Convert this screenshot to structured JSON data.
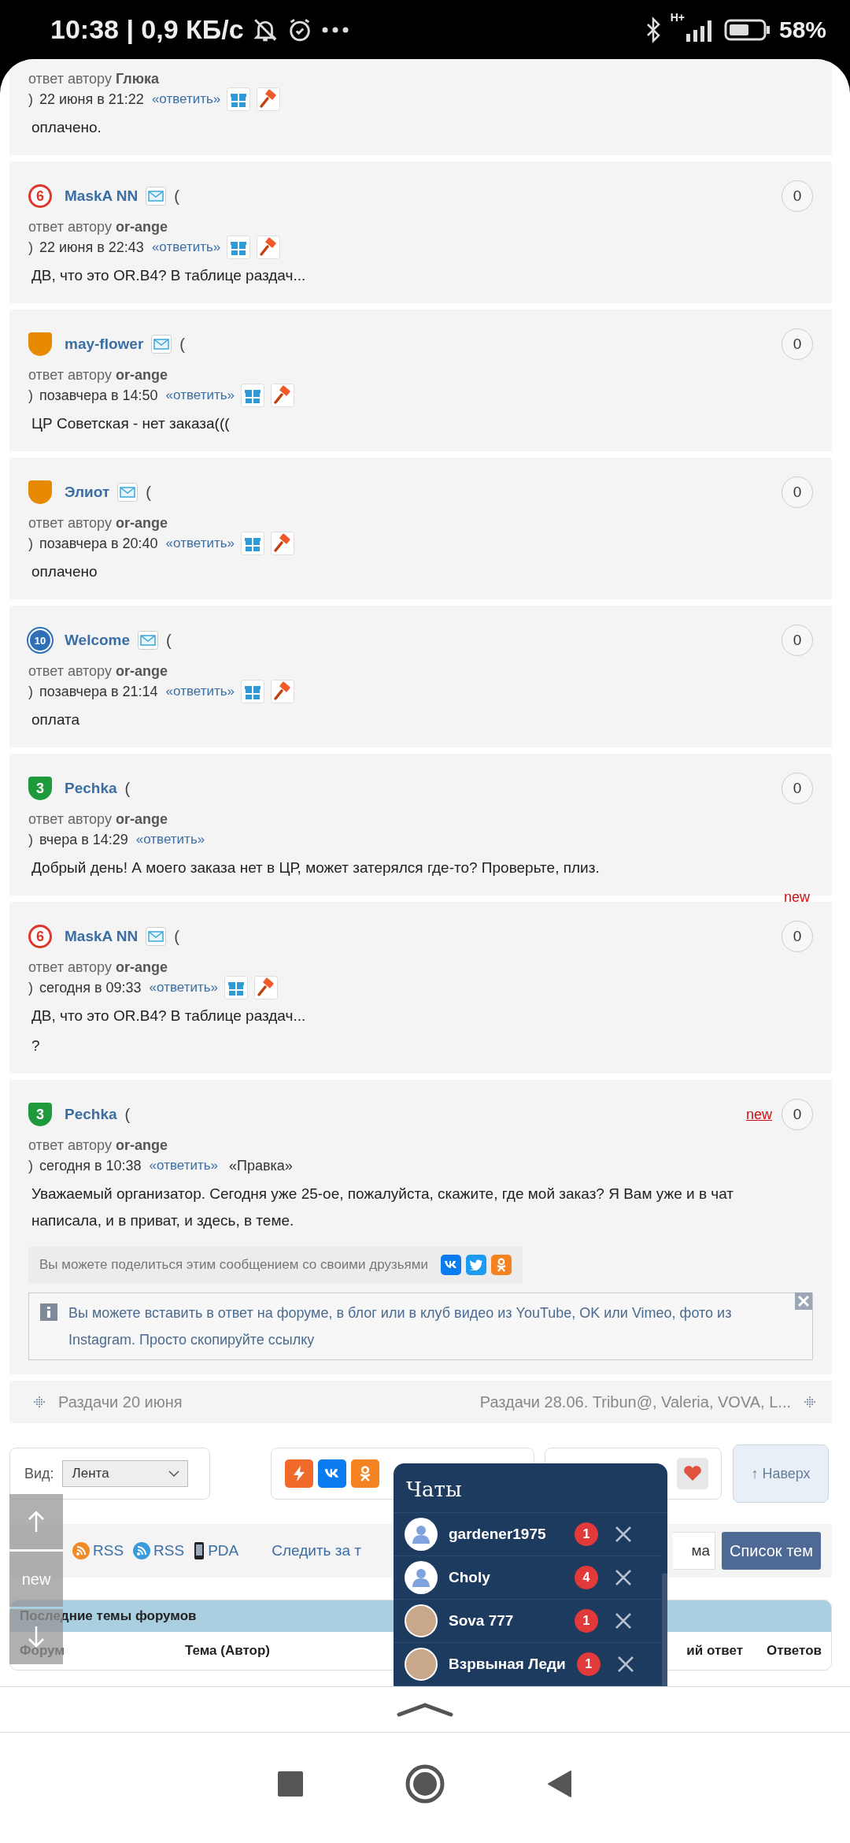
{
  "status_bar": {
    "time_speed": "10:38 | 0,9 КБ/с",
    "network": "H+",
    "battery": "58%"
  },
  "posts": [
    {
      "close_paren": ")",
      "reply_prefix": "ответ автору",
      "reply_to": "Глюка",
      "date": "22 июня в 21:22",
      "reply_link": "«ответить»",
      "tools": true,
      "body": [
        "оплачено."
      ]
    },
    {
      "rank": {
        "kind": "circle",
        "label": "6",
        "color": "#e0352b"
      },
      "name": "MaskA NN",
      "mail": true,
      "paren": "(",
      "count": "0",
      "reply_prefix": "ответ автору",
      "reply_to": "or-ange",
      "close_paren": ")",
      "date": "22 июня в 22:43",
      "reply_link": "«ответить»",
      "tools": true,
      "body": [
        "ДВ, что это OR.B4? В таблице раздач..."
      ]
    },
    {
      "rank": {
        "kind": "shield",
        "color": "#e88a00"
      },
      "name": "may-flower",
      "mail": true,
      "paren": "(",
      "count": "0",
      "reply_prefix": "ответ автору",
      "reply_to": "or-ange",
      "close_paren": ")",
      "date": "позавчера в 14:50",
      "reply_link": "«ответить»",
      "tools": true,
      "body": [
        "ЦР Советская - нет заказа((("
      ]
    },
    {
      "rank": {
        "kind": "shield",
        "color": "#e88a00"
      },
      "name": "Элиот",
      "mail": true,
      "paren": "(",
      "count": "0",
      "reply_prefix": "ответ автору",
      "reply_to": "or-ange",
      "close_paren": ")",
      "date": "позавчера в 20:40",
      "reply_link": "«ответить»",
      "tools": true,
      "body": [
        "оплачено"
      ]
    },
    {
      "rank": {
        "kind": "medal",
        "label": "10",
        "color": "#2f6fb8"
      },
      "name": "Welcome",
      "mail": true,
      "paren": "(",
      "count": "0",
      "reply_prefix": "ответ автору",
      "reply_to": "or-ange",
      "close_paren": ")",
      "date": "позавчера в 21:14",
      "reply_link": "«ответить»",
      "tools": true,
      "body": [
        "оплата"
      ]
    },
    {
      "rank": {
        "kind": "shield",
        "label": "3",
        "color": "#1e9a3c"
      },
      "name": "Pechka",
      "mail": false,
      "paren": "(",
      "count": "0",
      "reply_prefix": "ответ автору",
      "reply_to": "or-ange",
      "close_paren": ")",
      "date": "вчера в 14:29",
      "reply_link": "«ответить»",
      "tools": false,
      "body": [
        "Добрый день! А моего заказа нет в ЦР, может затерялся где-то? Проверьте, плиз."
      ]
    },
    {
      "rank": {
        "kind": "circle",
        "label": "6",
        "color": "#e0352b"
      },
      "name": "MaskA NN",
      "mail": true,
      "paren": "(",
      "count": "0",
      "new_mark": {
        "text": "new",
        "kind": "label"
      },
      "reply_prefix": "ответ автору",
      "reply_to": "or-ange",
      "close_paren": ")",
      "date": "сегодня в 09:33",
      "reply_link": "«ответить»",
      "tools": true,
      "body": [
        "ДВ, что это OR.B4? В таблице раздач...",
        "?"
      ]
    },
    {
      "rank": {
        "kind": "shield",
        "label": "3",
        "color": "#1e9a3c"
      },
      "name": "Pechka",
      "mail": false,
      "paren": "(",
      "count": "0",
      "new_mark": {
        "text": "new",
        "kind": "link"
      },
      "reply_prefix": "ответ автору",
      "reply_to": "or-ange",
      "close_paren": ")",
      "date": "сегодня в 10:38",
      "reply_link": "«ответить»",
      "edit_link": "«Правка»",
      "tools": false,
      "body": [
        "Уважаемый организатор. Сегодня уже 25-ое, пожалуйста, скажите, где мой заказ? Я Вам уже и в чат написала, и в приват, и здесь, в теме."
      ],
      "share_text": "Вы можете поделиться этим сообщением со своими друзьями",
      "notice": {
        "text": "Вы можете вставить в ответ на форуме, в блог или в клуб видео из YouTube, OK или Vimeo, фото из Instagram. Просто скопируйте ссылку",
        "closable": true
      }
    }
  ],
  "thread_nav": {
    "prev": "Раздачи 20 июня",
    "next": "Раздачи 28.06. Tribun@, Valeria, VOVA, L..."
  },
  "toolbar": {
    "view_label": "Вид:",
    "view_value": "Лента",
    "top_button": "↑ Наверх"
  },
  "feeds": [
    {
      "kind": "rss-orange",
      "label": "RSS"
    },
    {
      "kind": "rss-blue",
      "label": "RSS"
    },
    {
      "kind": "phone",
      "label": "PDA"
    }
  ],
  "follow_link": "Следить за т",
  "search_value": "ма",
  "topics_button": "Список тем",
  "latest": {
    "title": "Последние темы форумов",
    "columns": [
      "Форум",
      "Тема (Автор)",
      "ий ответ",
      "Ответов"
    ]
  },
  "float_buttons": {
    "new_label": "new"
  },
  "chats": {
    "title": "Чаты",
    "items": [
      {
        "name": "gardener1975",
        "unread": "1",
        "kind": "default"
      },
      {
        "name": "Choly",
        "unread": "4",
        "kind": "default"
      },
      {
        "name": "Sova 777",
        "unread": "1",
        "kind": "photo"
      },
      {
        "name": "Взрвыная Леди",
        "unread": "1",
        "kind": "photo"
      }
    ]
  }
}
